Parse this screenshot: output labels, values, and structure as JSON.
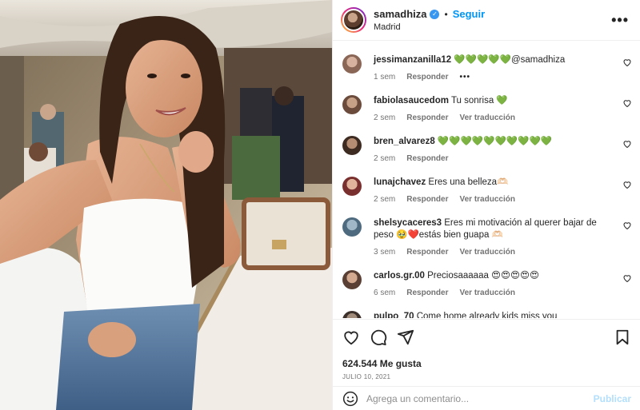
{
  "header": {
    "username": "samadhiza",
    "verified_icon": "verified-badge-icon",
    "follow_label": "Seguir",
    "location": "Madrid",
    "more_icon": "more-options-icon"
  },
  "comments": [
    {
      "user": "jessimanzanilla12",
      "text": "💚💚💚💚💚@samadhiza",
      "time": "1 sem",
      "reply": "Responder",
      "translate": "",
      "extra": "•••"
    },
    {
      "user": "fabiolasaucedom",
      "text": "Tu sonrisa 💚",
      "time": "2 sem",
      "reply": "Responder",
      "translate": "Ver traducción"
    },
    {
      "user": "bren_alvarez8",
      "text": "💚💚💚💚💚💚💚💚💚💚",
      "time": "2 sem",
      "reply": "Responder",
      "translate": ""
    },
    {
      "user": "lunajchavez",
      "text": "Eres una belleza🫶🏻",
      "time": "2 sem",
      "reply": "Responder",
      "translate": "Ver traducción"
    },
    {
      "user": "shelsycaceres3",
      "text": "Eres mi motivación al querer bajar de peso 🥹❤️estás bien guapa 🫶🏻",
      "time": "3 sem",
      "reply": "Responder",
      "translate": "Ver traducción"
    },
    {
      "user": "carlos.gr.00",
      "text": "Preciosaaaaaa 😍😍😍😍😍",
      "time": "6 sem",
      "reply": "Responder",
      "translate": "Ver traducción"
    },
    {
      "user": "pulpo_70",
      "text": "Come home already kids miss you",
      "time": "",
      "reply": "",
      "translate": ""
    }
  ],
  "actions": {
    "likes": "624.544 Me gusta",
    "date": "JULIO 10, 2021",
    "comment_placeholder": "Agrega un comentario...",
    "publish_label": "Publicar"
  },
  "colors": {
    "accent": "#0095f6",
    "publish_disabled": "#b2dffc",
    "verified": "#3897f0"
  }
}
